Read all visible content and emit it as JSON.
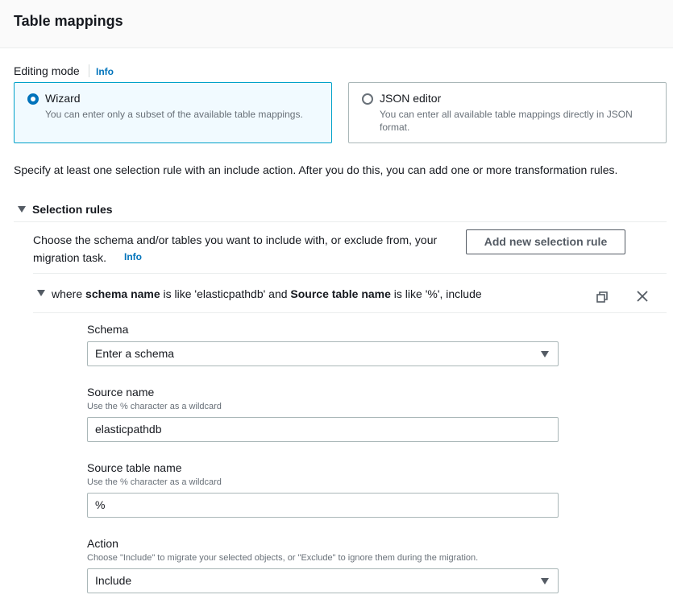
{
  "header": {
    "title": "Table mappings"
  },
  "editing_mode": {
    "label": "Editing mode",
    "info": "Info",
    "options": [
      {
        "title": "Wizard",
        "description": "You can enter only a subset of the available table mappings.",
        "selected": true
      },
      {
        "title": "JSON editor",
        "description": "You can enter all available table mappings directly in JSON format.",
        "selected": false
      }
    ]
  },
  "intro": "Specify at least one selection rule with an include action. After you do this, you can add one or more transformation rules.",
  "selection_rules": {
    "title": "Selection rules",
    "description": "Choose the schema and/or tables you want to include with, or exclude from, your migration task.",
    "info": "Info",
    "add_button": "Add new selection rule",
    "rule": {
      "summary_parts": [
        "where ",
        "schema name",
        " is like 'elasticpathdb' and ",
        "Source table name",
        " is like '%', include"
      ],
      "fields": {
        "schema": {
          "label": "Schema",
          "value": "Enter a schema"
        },
        "source_name": {
          "label": "Source name",
          "hint": "Use the % character as a wildcard",
          "value": "elasticpathdb"
        },
        "source_table_name": {
          "label": "Source table name",
          "hint": "Use the % character as a wildcard",
          "value": "%"
        },
        "action": {
          "label": "Action",
          "hint": "Choose \"Include\" to migrate your selected objects, or \"Exclude\" to ignore them during the migration.",
          "value": "Include"
        }
      }
    }
  },
  "colors": {
    "accent": "#0073bb",
    "selected_border": "#00a1c9",
    "selected_bg": "#f1faff"
  }
}
